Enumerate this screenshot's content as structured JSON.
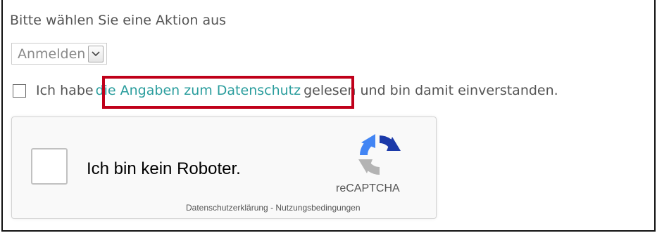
{
  "form": {
    "prompt": "Bitte wählen Sie eine Aktion aus",
    "action_select": {
      "value": "Anmelden"
    },
    "consent": {
      "text_before": "Ich habe",
      "link_text": "die Angaben zum Datenschutz",
      "text_after": "gelesen und bin damit einverstanden.",
      "checked": false
    }
  },
  "captcha": {
    "label": "Ich bin kein Roboter.",
    "brand": "reCAPTCHA",
    "privacy_link": "Datenschutzerklärung",
    "separator": "-",
    "terms_link": "Nutzungsbedingungen",
    "checked": false
  },
  "annotation": {
    "highlight_color": "#c0001a"
  },
  "colors": {
    "link": "#2a9d9d",
    "text": "#555555",
    "recaptcha_blue": "#1c3aa9",
    "recaptcha_light_blue": "#4285f4",
    "recaptcha_gray": "#b3b3b3"
  },
  "icons": {
    "dropdown": "chevron-down-icon",
    "recaptcha": "recaptcha-logo-icon"
  }
}
